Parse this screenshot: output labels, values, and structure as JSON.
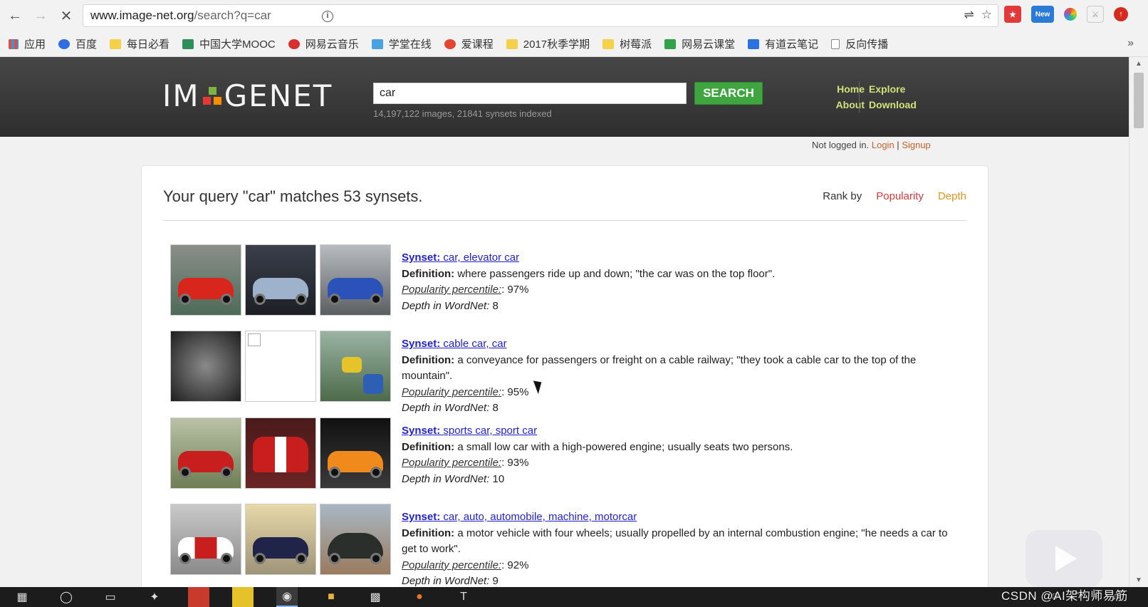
{
  "browser": {
    "url_host": "www.image-net.org",
    "url_path": "/search?q=car",
    "bookmarks": [
      "应用",
      "百度",
      "每日必看",
      "中国大学MOOC",
      "网易云音乐",
      "学堂在线",
      "爱课程",
      "2017秋季学期",
      "树莓派",
      "网易云课堂",
      "有道云笔记",
      "反向传播"
    ],
    "more": "»",
    "ext_new_label": "New"
  },
  "header": {
    "logo_left": "IM",
    "logo_right": "GENET",
    "search_value": "car",
    "search_button": "SEARCH",
    "index_stats": "14,197,122 images, 21841 synsets indexed",
    "nav": {
      "home": "Home",
      "about": "About",
      "explore": "Explore",
      "download": "Download"
    }
  },
  "auth": {
    "status": "Not logged in.",
    "login": "Login",
    "sep": "|",
    "signup": "Signup"
  },
  "main": {
    "query_title": "Your query \"car\" matches 53 synsets.",
    "rank_label": "Rank by",
    "rank_popularity": "Popularity",
    "rank_depth": "Depth",
    "labels": {
      "synset": "Synset:",
      "definition": "Definition:",
      "popularity": "Popularity percentile:",
      "depth": "Depth in WordNet:"
    },
    "results": [
      {
        "synset": "car, elevator car",
        "definition": "where passengers ride up and down; \"the car was on the top floor\".",
        "popularity": ": 97%",
        "depth": " 8"
      },
      {
        "synset": "cable car, car",
        "definition": "a conveyance for passengers or freight on a cable railway; \"they took a cable car to the top of the mountain\".",
        "popularity": ": 95%",
        "depth": " 8"
      },
      {
        "synset": "sports car, sport car",
        "definition": "a small low car with a high-powered engine; usually seats two persons.",
        "popularity": ": 93%",
        "depth": " 10"
      },
      {
        "synset": "car, auto, automobile, machine, motorcar",
        "definition": "a motor vehicle with four wheels; usually propelled by an internal combustion engine; \"he needs a car to get to work\".",
        "popularity": ": 92%",
        "depth": " 9"
      }
    ]
  },
  "watermark": "CSDN @AI架构师易筋",
  "colors": {
    "header_bg": "#3a3a3a",
    "search_green": "#3fa63f",
    "link_blue": "#2222cc",
    "popularity_red": "#d23b3b",
    "depth_orange": "#e0961e"
  }
}
